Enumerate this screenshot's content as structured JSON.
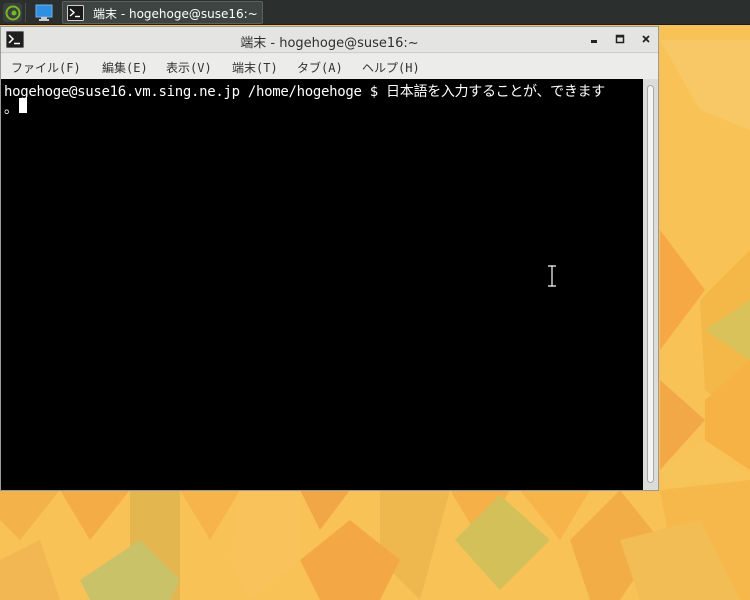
{
  "panel": {
    "logo_icon": "opensuse-gecko-icon",
    "desktop_icon": "show-desktop-icon",
    "task": {
      "icon": "terminal-icon",
      "label": "端末 - hogehoge@suse16:~"
    }
  },
  "window": {
    "title": "端末 - hogehoge@suse16:~",
    "icon": "terminal-icon",
    "buttons": {
      "minimize": "▪",
      "maximize": "▫",
      "close": "×"
    },
    "menu": [
      {
        "label": "ファイル(F)"
      },
      {
        "label": "編集(E)"
      },
      {
        "label": "表示(V)"
      },
      {
        "label": "端末(T)"
      },
      {
        "label": "タブ(A)"
      },
      {
        "label": "ヘルプ(H)"
      }
    ],
    "terminal": {
      "line1": "hogehoge@suse16.vm.sing.ne.jp /home/hogehoge $ 日本語を入力することが、できます",
      "line2": "。"
    }
  },
  "colors": {
    "panel": "#2b2f2e",
    "terminal_bg": "#000000",
    "terminal_fg": "#ffffff",
    "wallpaper": "#f7bd4f"
  }
}
